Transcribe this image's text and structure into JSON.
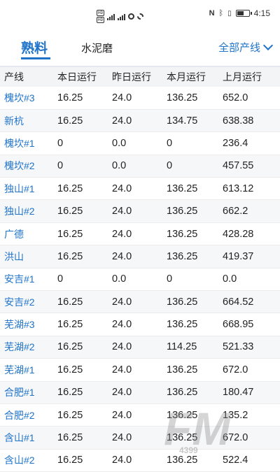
{
  "status_bar": {
    "time": "4:15",
    "battery_level": 0.6,
    "left_chips": [
      "HD",
      "HD"
    ],
    "icons": [
      "signal-icon",
      "wifi-icon",
      "app-icon",
      "nfc-icon",
      "bluetooth-icon",
      "vibrate-icon",
      "battery-icon"
    ]
  },
  "tabs": {
    "active": "熟料",
    "other": "水泥磨",
    "filter_label": "全部产线"
  },
  "table": {
    "headers": [
      "产线",
      "本日运行",
      "昨日运行",
      "本月运行",
      "上月运行"
    ],
    "rows": [
      [
        "槐坎#3",
        "16.25",
        "24.0",
        "136.25",
        "652.0"
      ],
      [
        "新杭",
        "16.25",
        "24.0",
        "134.75",
        "638.38"
      ],
      [
        "槐坎#1",
        "0",
        "0.0",
        "0",
        "236.4"
      ],
      [
        "槐坎#2",
        "0",
        "0.0",
        "0",
        "457.55"
      ],
      [
        "独山#1",
        "16.25",
        "24.0",
        "136.25",
        "613.12"
      ],
      [
        "独山#2",
        "16.25",
        "24.0",
        "136.25",
        "662.2"
      ],
      [
        "广德",
        "16.25",
        "24.0",
        "136.25",
        "428.28"
      ],
      [
        "洪山",
        "16.25",
        "24.0",
        "136.25",
        "419.37"
      ],
      [
        "安吉#1",
        "0",
        "0.0",
        "0",
        "0.0"
      ],
      [
        "安吉#2",
        "16.25",
        "24.0",
        "136.25",
        "664.52"
      ],
      [
        "芜湖#3",
        "16.25",
        "24.0",
        "136.25",
        "668.95"
      ],
      [
        "芜湖#2",
        "16.25",
        "24.0",
        "114.25",
        "521.33"
      ],
      [
        "芜湖#1",
        "16.25",
        "24.0",
        "136.25",
        "672.0"
      ],
      [
        "合肥#1",
        "16.25",
        "24.0",
        "136.25",
        "180.47"
      ],
      [
        "合肥#2",
        "16.25",
        "24.0",
        "136.25",
        "135.2"
      ],
      [
        "含山#1",
        "16.25",
        "24.0",
        "136.25",
        "672.0"
      ],
      [
        "含山#2",
        "16.25",
        "24.0",
        "136.25",
        "522.4"
      ]
    ]
  },
  "watermark": {
    "text": "FM",
    "sub": "4399"
  },
  "colors": {
    "accent": "#1f74c9"
  }
}
